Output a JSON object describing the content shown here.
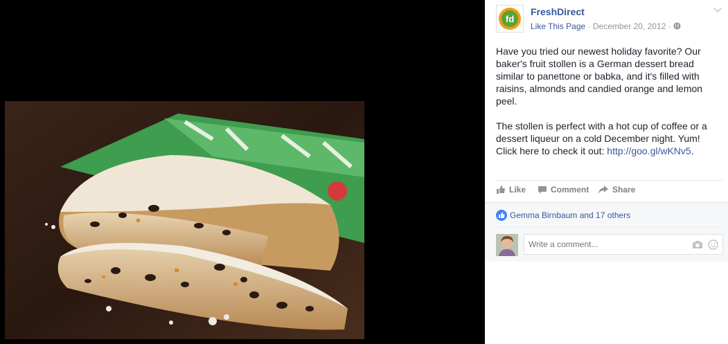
{
  "page": {
    "name": "FreshDirect",
    "like_label": "Like This Page",
    "separator": "·",
    "date": "December 20, 2012",
    "logo_text": "fd"
  },
  "post": {
    "paragraph1": "Have you tried our newest holiday favorite? Our baker's fruit stollen is a German dessert bread similar to panettone or babka, and it's filled with raisins, almonds and candied orange and lemon peel.",
    "paragraph2_text": "The stollen is perfect with a hot cup of coffee or a dessert liqueur on a cold December night. Yum! Click here to check it out: ",
    "link": "http://goo.gl/wKNv5",
    "link_suffix": "."
  },
  "actions": {
    "like": "Like",
    "comment": "Comment",
    "share": "Share"
  },
  "likes": {
    "text": "Gemma Birnbaum and 17 others"
  },
  "comment": {
    "placeholder": "Write a comment..."
  },
  "colors": {
    "link": "#365899",
    "brand_green": "#5aa23a",
    "brand_orange": "#f39c12",
    "like_blue": "#4080ff"
  },
  "icons": [
    "globe-icon",
    "chevron-down-icon",
    "like-icon",
    "comment-icon",
    "share-icon",
    "thumbs-up-icon",
    "camera-icon",
    "smiley-icon"
  ]
}
